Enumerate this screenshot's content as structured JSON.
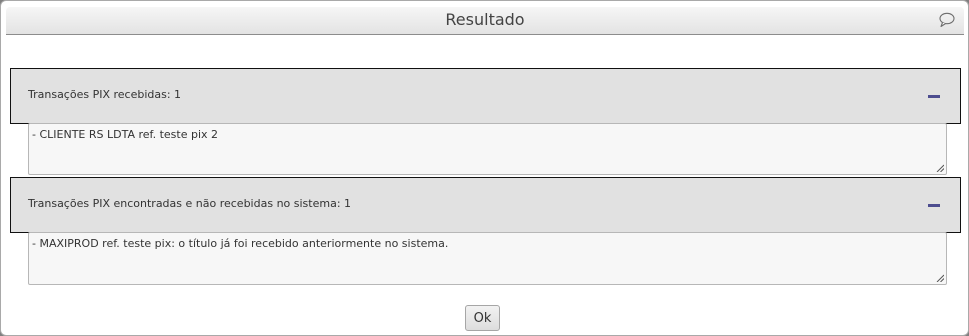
{
  "dialog": {
    "title": "Resultado",
    "ok_label": "Ok"
  },
  "sections": [
    {
      "header": "Transações PIX recebidas: 1",
      "items": [
        "- CLIENTE RS LDTA ref. teste pix 2"
      ]
    },
    {
      "header": "Transações PIX encontradas e não recebidas no sistema: 1",
      "items": [
        "- MAXIPROD ref. teste pix: o título já foi recebido anteriormente no sistema."
      ]
    }
  ],
  "colors": {
    "header_bg": "#e1e1e1",
    "accent": "#4d4d8f"
  },
  "icons": {
    "title": "speech-bubble-icon",
    "section": "collapse-minus-icon"
  }
}
